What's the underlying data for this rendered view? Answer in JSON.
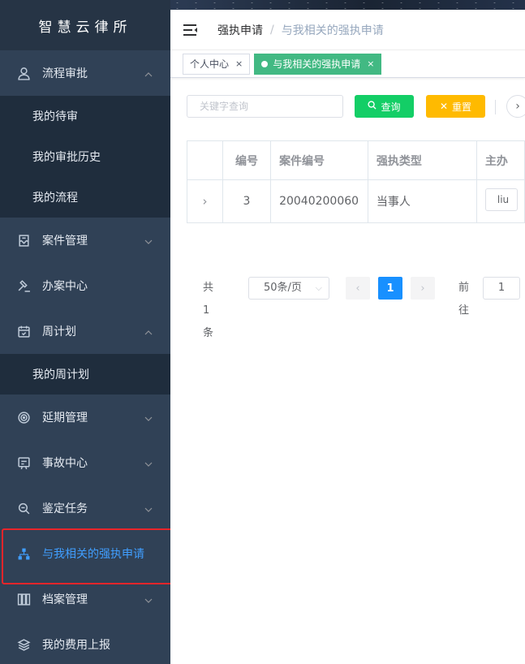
{
  "app": {
    "title": "智慧云律所"
  },
  "sidebar": {
    "items": [
      {
        "label": "流程审批",
        "icon": "user-icon",
        "expanded": true,
        "children": [
          "我的待审",
          "我的审批历史",
          "我的流程"
        ]
      },
      {
        "label": "案件管理",
        "icon": "case-icon",
        "expanded": false
      },
      {
        "label": "办案中心",
        "icon": "gavel-icon",
        "expanded": false
      },
      {
        "label": "周计划",
        "icon": "calendar-icon",
        "expanded": true,
        "children": [
          "我的周计划"
        ]
      },
      {
        "label": "延期管理",
        "icon": "target-icon",
        "expanded": false
      },
      {
        "label": "事故中心",
        "icon": "report-icon",
        "expanded": false
      },
      {
        "label": "鉴定任务",
        "icon": "inspect-icon",
        "expanded": false
      },
      {
        "label": "与我相关的强执申请",
        "icon": "tree-icon",
        "active": true
      },
      {
        "label": "档案管理",
        "icon": "archive-icon",
        "expanded": false
      },
      {
        "label": "我的费用上报",
        "icon": "layers-icon",
        "expanded": false
      }
    ],
    "active_color": "#409eff",
    "bg_color": "#304156"
  },
  "navbar": {
    "breadcrumb": [
      "强执申请",
      "与我相关的强执申请"
    ]
  },
  "tags": [
    {
      "label": "个人中心",
      "active": false
    },
    {
      "label": "与我相关的强执申请",
      "active": true
    }
  ],
  "toolbar": {
    "search_placeholder": "关键字查询",
    "search_button": "查询",
    "reset_button": "重置"
  },
  "table": {
    "columns": [
      "编号",
      "案件编号",
      "强执类型",
      "主办"
    ],
    "rows": [
      {
        "id": "3",
        "case_no": "20040200060",
        "type": "当事人",
        "host": "liu"
      }
    ]
  },
  "pagination": {
    "total": "共 1 条",
    "page_size": "50条/页",
    "current_page": "1",
    "goto_label": "前往",
    "goto_value": "1"
  },
  "colors": {
    "search_button": "#13ce66",
    "reset_button": "#ffba00",
    "active_tag": "#42b983",
    "page_active": "#1890ff",
    "highlight": "#e8252a"
  }
}
